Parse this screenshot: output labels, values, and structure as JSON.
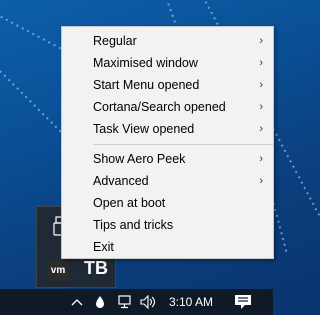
{
  "desktop": {},
  "context_menu": {
    "items": [
      {
        "label": "Regular",
        "has_submenu": true
      },
      {
        "label": "Maximised window",
        "has_submenu": true
      },
      {
        "label": "Start Menu opened",
        "has_submenu": true
      },
      {
        "label": "Cortana/Search opened",
        "has_submenu": true
      },
      {
        "label": "Task View opened",
        "has_submenu": true
      },
      {
        "label": "Show Aero Peek",
        "has_submenu": true
      },
      {
        "label": "Advanced",
        "has_submenu": true
      },
      {
        "label": "Open at boot",
        "has_submenu": false
      },
      {
        "label": "Tips and tricks",
        "has_submenu": false
      },
      {
        "label": "Exit",
        "has_submenu": false
      }
    ],
    "submenu_arrow": "›"
  },
  "tray_overflow": {
    "icons": [
      "usb-icon",
      "vmware-icon",
      "translucenttb-icon"
    ],
    "vmware_text": "vm",
    "tb_text": "TB"
  },
  "taskbar": {
    "chevron": "^",
    "clock": "3:10 AM",
    "icons": [
      "chevron-up-icon",
      "dropbox-icon",
      "network-icon",
      "volume-icon",
      "notification-icon"
    ]
  }
}
